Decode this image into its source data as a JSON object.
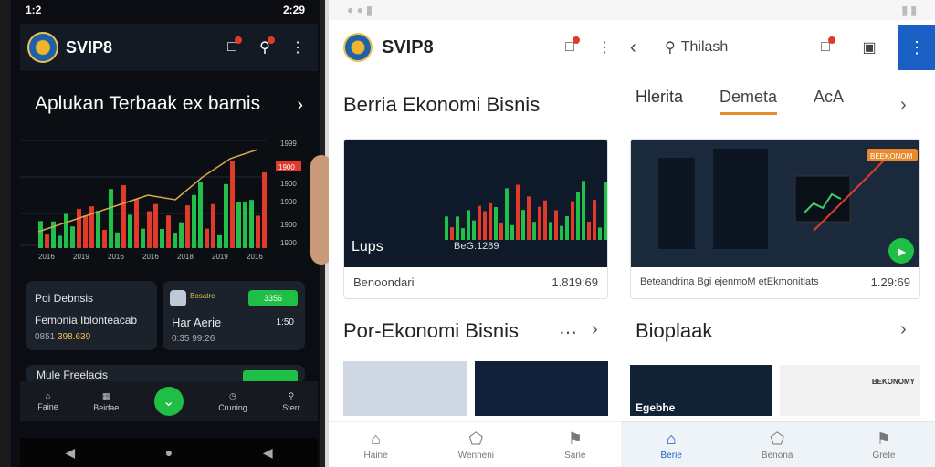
{
  "left_phone": {
    "status": {
      "left": "1:2",
      "time": "2:29"
    },
    "brand": "SVIP8",
    "hero_title": "Aplukan Terbaak  ex barnis",
    "price_ticks": [
      "1999",
      "1900",
      "1900",
      "1900",
      "1900",
      "1900",
      "1900"
    ],
    "price_tag": "1900",
    "x_ticks": [
      "2016",
      "2019",
      "2016",
      "2016",
      "2018",
      "2019",
      "2016"
    ],
    "card1": {
      "title": "Poi Debnsis",
      "subtitle": "Femonia Iblonteacab",
      "meta": "0851",
      "meta_value": "398.639"
    },
    "card2": {
      "badge": "Bosatrc",
      "pill": "3356",
      "title": "Har Aerie",
      "value": "1:50",
      "meta": "0:35 99:26"
    },
    "card3": {
      "title": "Mule Freelacis"
    },
    "bottom_nav": [
      "Faine",
      "Beidae",
      "",
      "Cruning",
      "Sterr"
    ]
  },
  "right_screen": {
    "left_pane": {
      "brand": "SVIP8",
      "section1": "Berria Ekonomi Bisnis",
      "card1": {
        "overlay": "Lups",
        "overlay2": "BeG:1289",
        "caption": "Benoondari",
        "value": "1.819:69"
      },
      "section2": "Por-Ekonomi Bisnis",
      "bottom_nav": [
        "Haine",
        "Wenheni",
        "Sarie"
      ]
    },
    "right_pane": {
      "search_label": "Thilash",
      "tabs": [
        "Hlerita",
        "Demeta",
        "AcA"
      ],
      "card1": {
        "badge": "BEEKONOM",
        "caption": "Beteandrina Bgi ejenmoM etEkmonitlats",
        "value": "1.29:69"
      },
      "section2": "Bioplaak",
      "card_bottom": {
        "overlay": "Egebhe",
        "label": "BEKONOMY"
      },
      "bottom_nav": [
        "Berie",
        "Benona",
        "Grete"
      ]
    }
  },
  "colors": {
    "green": "#20c04a",
    "red": "#e23a2a",
    "blue": "#1a5fc4",
    "accent_orange": "#e98a2a"
  }
}
